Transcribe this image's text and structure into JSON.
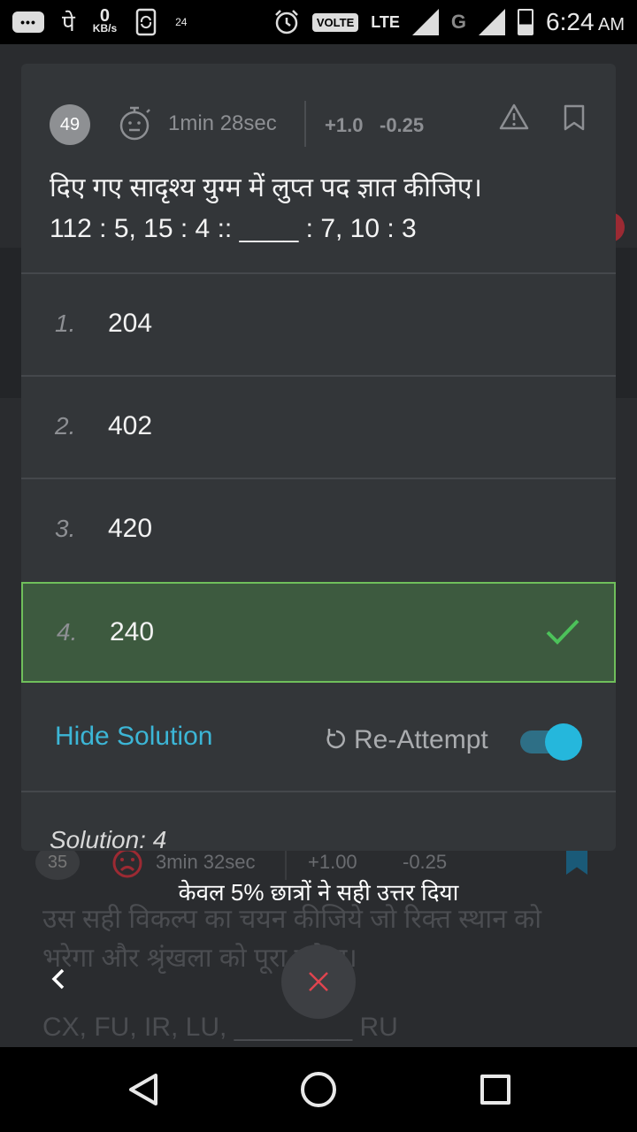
{
  "status_bar": {
    "chat_icon_label": "•••",
    "app_glyph": "पे",
    "net_speed_value": "0",
    "net_speed_unit": "KB/s",
    "small_badge": "24",
    "volte": "VOLTE",
    "lte": "LTE",
    "g_label": "G",
    "time": "6:24",
    "ampm": "AM"
  },
  "question": {
    "number": "49",
    "time_taken": "1min 28sec",
    "positive_marks": "+1.0",
    "negative_marks": "-0.25",
    "text_line1": "दिए गए सादृश्य युग्म में लुप्त पद ज्ञात कीजिए।",
    "text_line2": "112 : 5, 15 : 4 :: ____ : 7, 10 : 3"
  },
  "options": [
    {
      "num": "1.",
      "value": "204"
    },
    {
      "num": "2.",
      "value": "402"
    },
    {
      "num": "3.",
      "value": "420"
    },
    {
      "num": "4.",
      "value": "240",
      "correct": true
    }
  ],
  "solution_row": {
    "hide_solution": "Hide Solution",
    "reattempt": "Re-Attempt",
    "toggle_on": true,
    "solution_label": "Solution: 4"
  },
  "background_question": {
    "number": "35",
    "time_taken": "3min 32sec",
    "positive_marks": "+1.00",
    "negative_marks": "-0.25",
    "text": "उस सही विकल्प का चयन कीजिये जो रिक्त स्थान को भरेगा और श्रृंखला को पूरा करेगा।",
    "series": "CX, FU, IR, LU, ________ RU"
  },
  "toast": "केवल 5% छात्रों ने सही उत्तर दिया",
  "colors": {
    "accent": "#3cb6d6",
    "correct_bg": "#3d5a3f",
    "correct_border": "#6fbf5b",
    "card_bg": "#333639",
    "close_red": "#e0444f"
  }
}
